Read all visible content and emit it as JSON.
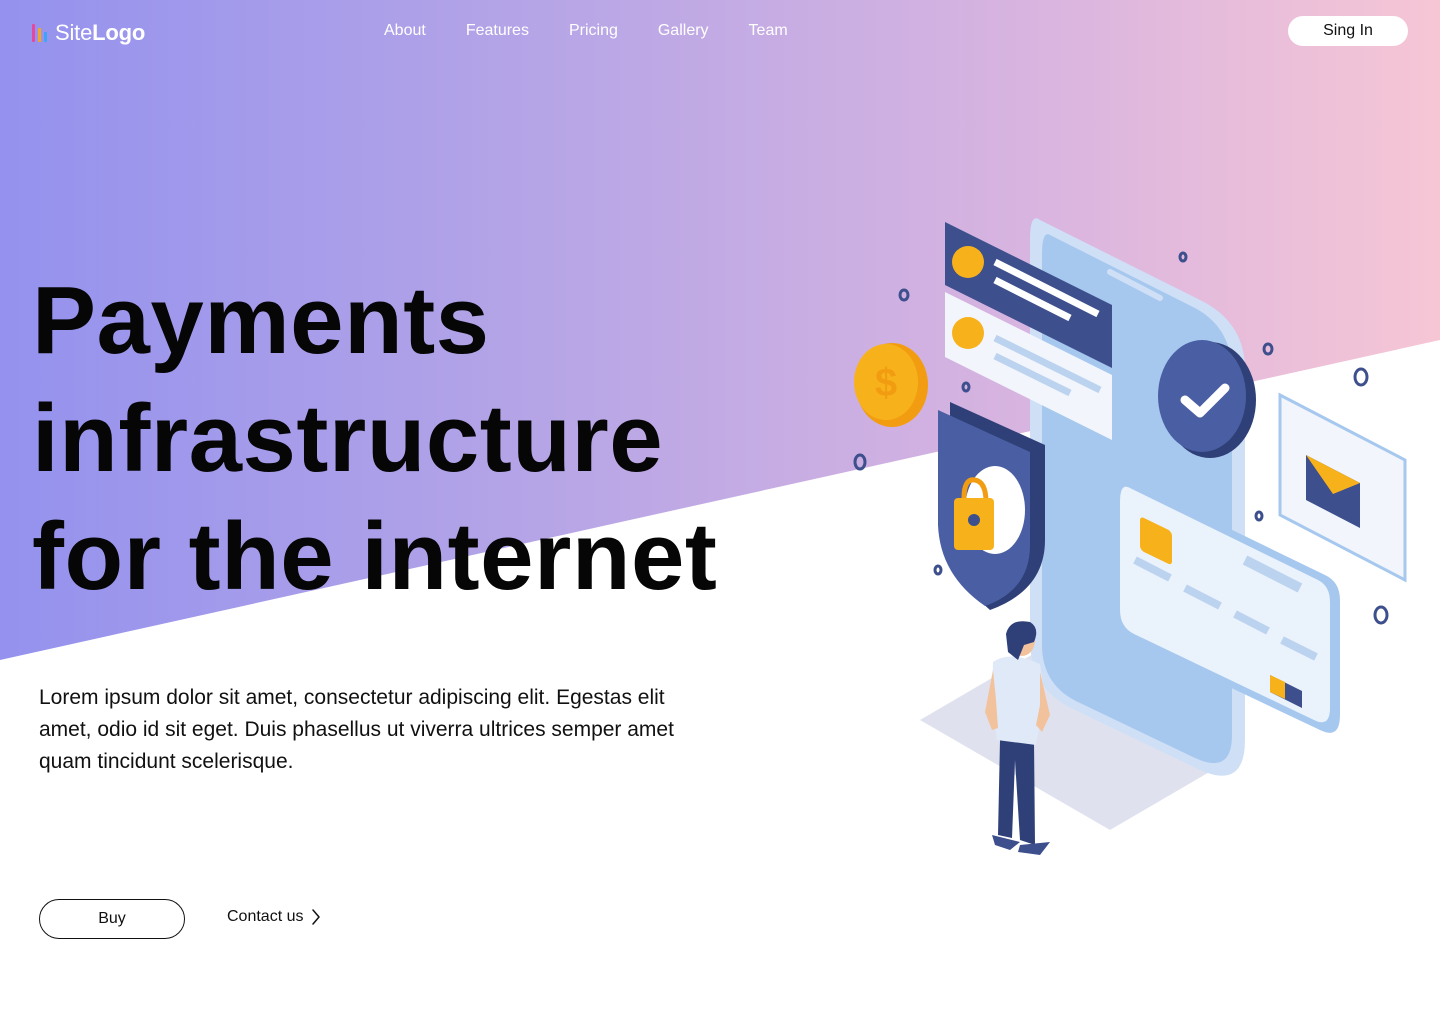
{
  "colors": {
    "gradient_start": "#9492ee",
    "gradient_end": "#f6c6d5",
    "logo_bar_1": "#e5489e",
    "logo_bar_2": "#f5a623",
    "logo_bar_3": "#3ea4f5",
    "ink": "#060606",
    "illustration_navy": "#3d4f8c",
    "illustration_light_blue": "#a6c8ee",
    "illustration_gold": "#f7b21b"
  },
  "header": {
    "logo_light": "Site",
    "logo_bold": "Logo",
    "nav_items": [
      "About",
      "Features",
      "Pricing",
      "Gallery",
      "Team"
    ],
    "signin_label": "Sing In"
  },
  "hero": {
    "headline_lines": [
      "Payments",
      "infrastructure",
      "for the internet"
    ],
    "lead": "Lorem ipsum dolor sit amet, consectetur adipiscing elit. Egestas elit amet, odio id sit eget. Duis phasellus ut viverra ultrices semper amet quam tincidunt scelerisque.",
    "buy_label": "Buy",
    "contact_label": "Contact us",
    "coin_symbol": "$"
  },
  "icons": {
    "logo": "bar-chart-icon",
    "contact": "chevron-right-icon",
    "illustration": [
      "smartphone",
      "dollar-coin",
      "shield-lock",
      "check-badge",
      "credit-card",
      "envelope",
      "person"
    ]
  }
}
